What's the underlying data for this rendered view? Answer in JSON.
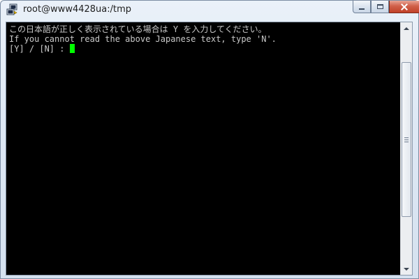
{
  "window": {
    "title": "root@www4428ua:/tmp",
    "icon": "putty-icon",
    "controls": [
      "minimize",
      "maximize",
      "close"
    ]
  },
  "terminal": {
    "lines": [
      "この日本語が正しく表示されている場合は Y を入力してください。",
      "If you cannot read the above Japanese text, type 'N'.",
      "[Y] / [N] : "
    ],
    "cursor_color": "#00ff00",
    "background": "#000000",
    "foreground": "#c8c8c8"
  },
  "scrollbar": {
    "position": 0.38
  }
}
